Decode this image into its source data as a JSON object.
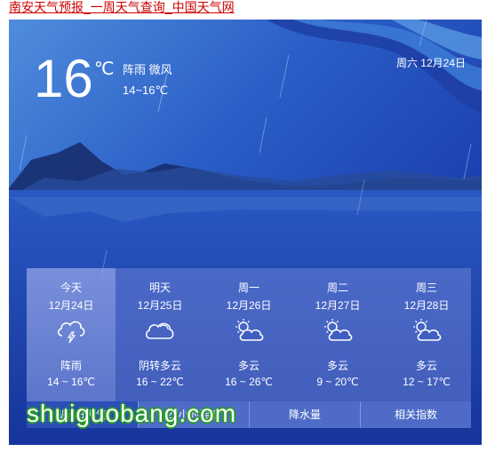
{
  "page_link": "南安天气预报_一周天气查询_中国天气网",
  "current": {
    "temp": "16",
    "unit": "℃",
    "condition": "阵雨 微风",
    "range": "14~16℃",
    "date": "周六 12月24日"
  },
  "forecast": [
    {
      "name": "今天",
      "date": "12月24日",
      "icon": "thunder-rain-cloud-icon",
      "condition": "阵雨",
      "range": "14 ~ 16℃"
    },
    {
      "name": "明天",
      "date": "12月25日",
      "icon": "cloud-icon",
      "condition": "阴转多云",
      "range": "16 ~ 22℃"
    },
    {
      "name": "周一",
      "date": "12月26日",
      "icon": "sun-cloud-icon",
      "condition": "多云",
      "range": "16 ~ 26℃"
    },
    {
      "name": "周二",
      "date": "12月27日",
      "icon": "sun-cloud-icon",
      "condition": "多云",
      "range": "9 ~ 20℃"
    },
    {
      "name": "周三",
      "date": "12月28日",
      "icon": "sun-cloud-icon",
      "condition": "多云",
      "range": "12 ~ 17℃"
    }
  ],
  "tabs": [
    "近5日天气",
    "24小时温度",
    "降水量",
    "相关指数"
  ],
  "watermark": "shuiguobang.com",
  "colors": {
    "link": "#cc0000",
    "panel_dark": "#1635a3",
    "panel_light": "#4f8ddc",
    "watermark_outline": "#2a9c2a"
  }
}
